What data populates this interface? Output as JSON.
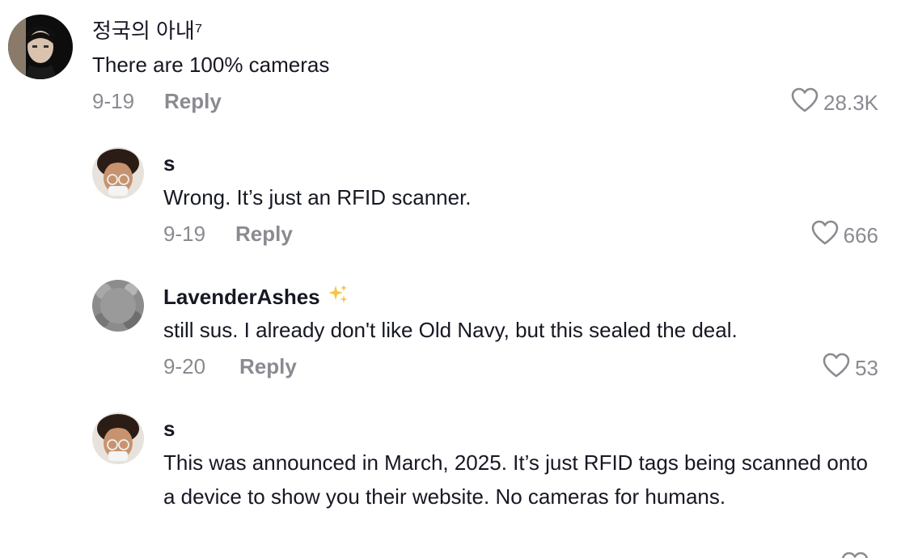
{
  "comments": [
    {
      "username": "정국의 아내⁷",
      "text": "There are 100% cameras",
      "date": "9-19",
      "reply_label": "Reply",
      "likes": "28.3K",
      "avatar_icon": "profile-photo"
    },
    {
      "username": "s",
      "text": "Wrong. It’s just an RFID scanner.",
      "date": "9-19",
      "reply_label": "Reply",
      "likes": "666",
      "avatar_icon": "profile-photo"
    },
    {
      "username": "LavenderAshes",
      "badge_icon": "sparkles-icon",
      "text": "still sus. I already don't like Old Navy, but this sealed the deal.",
      "date": "9-20",
      "reply_label": "Reply",
      "likes": "53",
      "avatar_icon": "profile-photo"
    },
    {
      "username": "s",
      "text": "This was announced in March, 2025. It’s just RFID tags being scanned onto a device to show you their website. No cameras for humans.",
      "avatar_icon": "profile-photo"
    }
  ],
  "colors": {
    "text_primary": "#161823",
    "text_secondary": "#8a8b91",
    "background": "#ffffff",
    "sparkle": "#f5c542"
  }
}
